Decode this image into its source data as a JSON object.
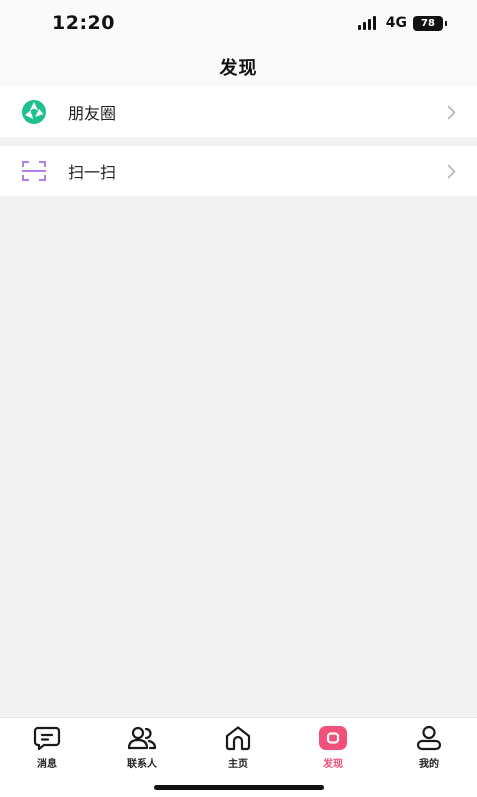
{
  "status_bar": {
    "time": "12:20",
    "network": "4G",
    "battery": "78"
  },
  "header": {
    "title": "发现"
  },
  "list": [
    {
      "label": "朋友圈",
      "icon": "moments-icon",
      "icon_color": "#1fbf8f"
    },
    {
      "label": "扫一扫",
      "icon": "scan-icon",
      "icon_color": "#b37feb"
    }
  ],
  "tabs": [
    {
      "label": "消息",
      "icon": "message-icon"
    },
    {
      "label": "联系人",
      "icon": "contacts-icon"
    },
    {
      "label": "主页",
      "icon": "home-icon"
    },
    {
      "label": "发现",
      "icon": "discover-icon",
      "active": true
    },
    {
      "label": "我的",
      "icon": "profile-icon"
    }
  ],
  "colors": {
    "accent": "#f0507a",
    "background": "#f2f2f2"
  }
}
